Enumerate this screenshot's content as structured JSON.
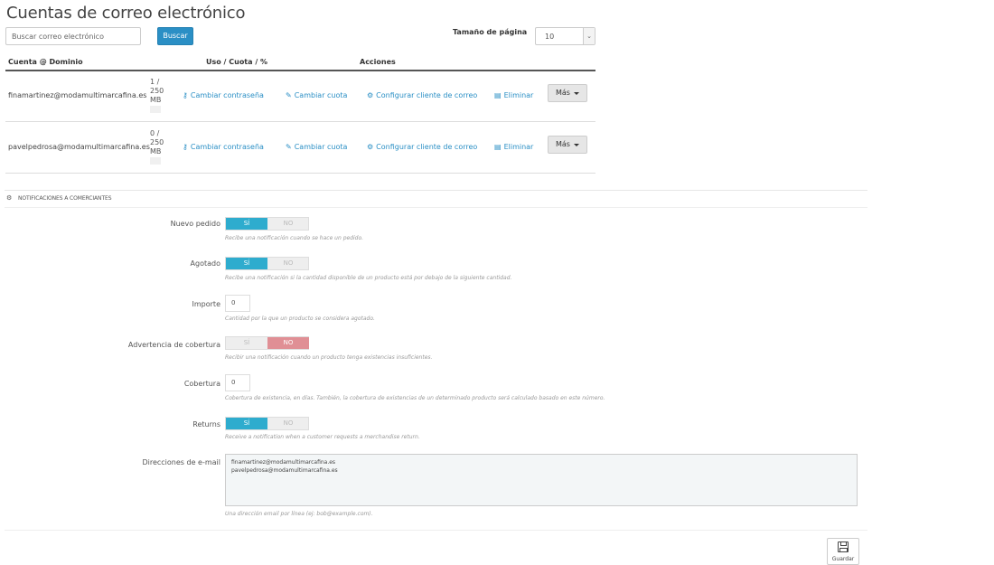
{
  "accounts": {
    "title": "Cuentas de correo electrónico",
    "search_placeholder": "Buscar correo electrónico",
    "search_button": "Buscar",
    "page_size_label": "Tamaño de página",
    "page_size_value": "10",
    "columns": [
      "Cuenta @ Dominio",
      "Uso / Cuota / %",
      "Acciones"
    ],
    "rows": [
      {
        "email": "finamartinez@modamultimarcafina.es",
        "quota_lines": [
          "1 /",
          "250",
          "MB"
        ],
        "actions": [
          "Cambiar contraseña",
          "Cambiar cuota",
          "Configurar cliente de correo",
          "Eliminar"
        ],
        "more": "Más"
      },
      {
        "email": "pavelpedrosa@modamultimarcafina.es",
        "quota_lines": [
          "0 /",
          "250",
          "MB"
        ],
        "actions": [
          "Cambiar contraseña",
          "Cambiar cuota",
          "Configurar cliente de correo",
          "Eliminar"
        ],
        "more": "Más"
      }
    ],
    "link_color": "#2a8fc5"
  },
  "notifications": {
    "header": "NOTIFICACIONES A COMERCIANTES",
    "switch_yes": "SÍ",
    "switch_no": "NO",
    "fields": [
      {
        "label": "Nuevo pedido",
        "state": "yes",
        "help": "Recibe una notificación cuando se hace un pedido."
      },
      {
        "label": "Agotado",
        "state": "yes",
        "help": "Recibe una notificación si la cantidad disponible de un producto está por debajo de la siguiente cantidad."
      },
      {
        "label": "Importe",
        "value": "0",
        "help": "Cantidad por la que un producto se considera agotado."
      },
      {
        "label": "Advertencia de cobertura",
        "state": "no",
        "help": "Recibir una notificación cuando un producto tenga existencias insuficientes."
      },
      {
        "label": "Cobertura",
        "value": "0",
        "help": "Cobertura de existencia, en días. También, la cobertura de existencias de un determinado producto será calculado basado en este número."
      },
      {
        "label": "Returns",
        "state": "yes",
        "help": "Receive a notification when a customer requests a merchandise return."
      },
      {
        "label": "Direcciones de e-mail",
        "help": "Una dirección email por línea (ej: bob@example.com)."
      }
    ],
    "emails": [
      "finamartinez@modamultimarcafina.es",
      "pavelpedrosa@modamultimarcafina.es"
    ],
    "save_label": "Guardar",
    "yes_color": "#2eacce",
    "no_color": "#e08f95"
  }
}
